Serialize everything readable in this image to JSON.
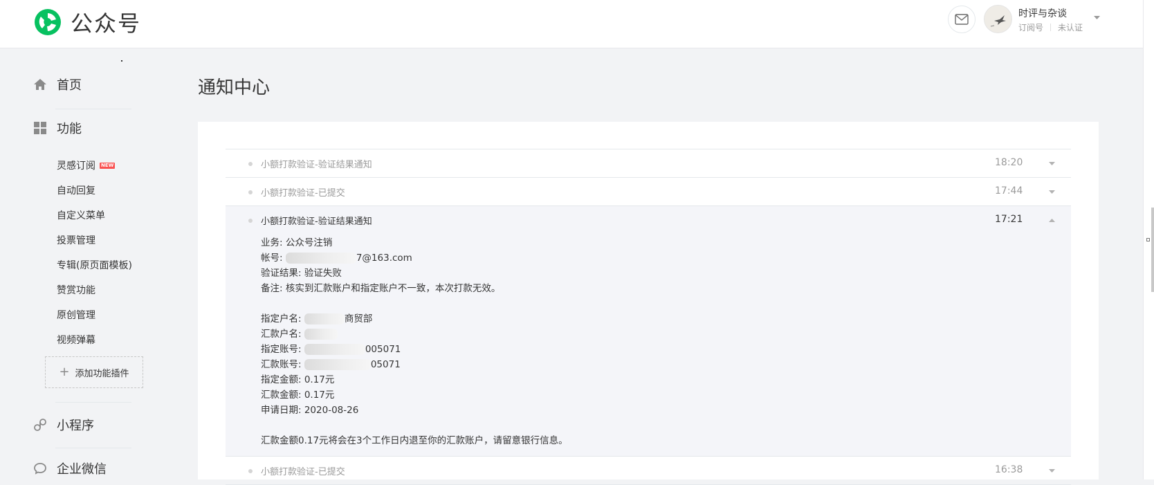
{
  "header": {
    "logo_text": "公众号",
    "account": {
      "name": "时评与杂谈",
      "type": "订阅号",
      "verify_status": "未认证"
    }
  },
  "sidebar": {
    "home": "首页",
    "functions": "功能",
    "function_items": [
      {
        "label": "灵感订阅",
        "badge": "NEW"
      },
      {
        "label": "自动回复"
      },
      {
        "label": "自定义菜单"
      },
      {
        "label": "投票管理"
      },
      {
        "label": "专辑(原页面模板)"
      },
      {
        "label": "赞赏功能"
      },
      {
        "label": "原创管理"
      },
      {
        "label": "视频弹幕"
      }
    ],
    "add_plugin": "添加功能插件",
    "mini_program": "小程序",
    "wecom": "企业微信"
  },
  "main": {
    "title": "通知中心",
    "notifications": [
      {
        "title": "小额打款验证-验证结果通知",
        "time": "18:20"
      },
      {
        "title": "小额打款验证-已提交",
        "time": "17:44"
      },
      {
        "title": "小额打款验证-验证结果通知",
        "time": "17:21",
        "detail": {
          "business": "业务: 公众号注销",
          "account_label": "帐号: ",
          "account_tail": "7@163.com",
          "result": "验证结果: 验证失败",
          "remark": "备注: 核实到汇款账户和指定账户不一致，本次打款无效。",
          "designated_name_label": "指定户名: ",
          "designated_name_tail": "商贸部",
          "remit_name_label": "汇款户名: ",
          "designated_acct_label": "指定账号: ",
          "designated_acct_tail": "005071",
          "remit_acct_label": "汇款账号: ",
          "remit_acct_tail": "05071",
          "designated_amount": "指定金额: 0.17元",
          "remit_amount": "汇款金额: 0.17元",
          "apply_date": "申请日期: 2020-08-26",
          "footer": "汇款金额0.17元将会在3个工作日内退至你的汇款账户，请留意银行信息。"
        }
      },
      {
        "title": "小额打款验证-已提交",
        "time": "16:38"
      }
    ]
  },
  "colors": {
    "brand_green": "#07c160",
    "muted_text": "#9a9a9a",
    "expanded_bg": "#f4f5f9"
  }
}
